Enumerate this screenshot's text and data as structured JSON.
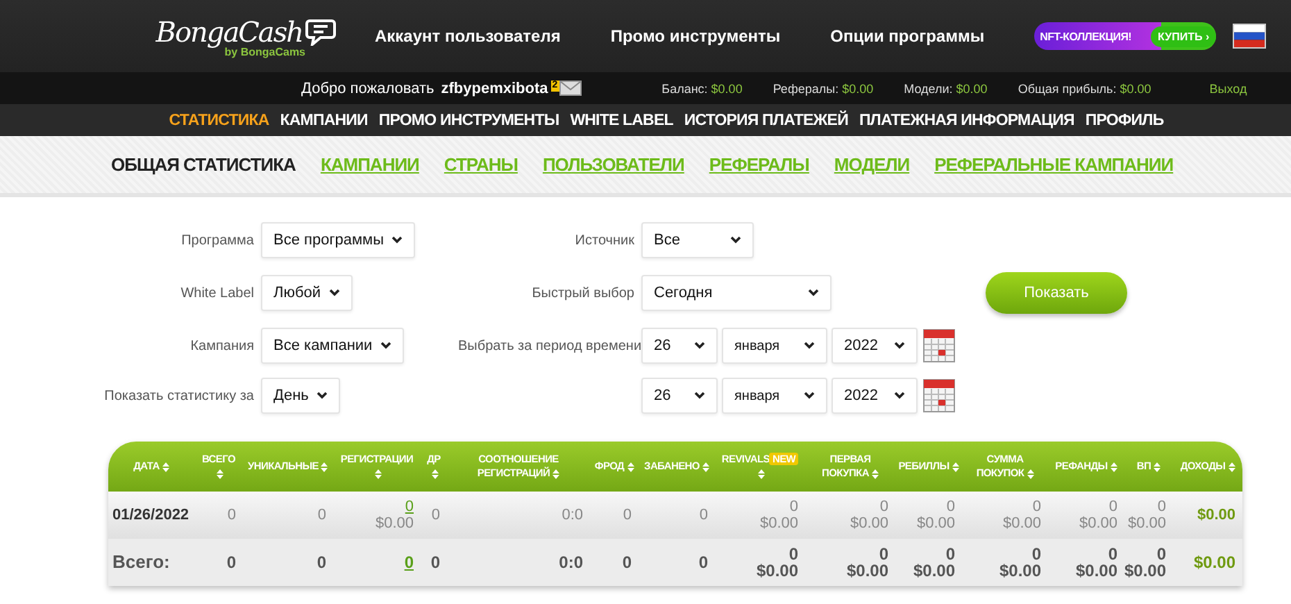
{
  "header": {
    "logo": "BongaCash",
    "logo_sub": "by BongaCams",
    "menu": [
      "Аккаунт пользователя",
      "Промо инструменты",
      "Опции программы"
    ],
    "promo": {
      "label": "NFT-КОЛЛЕКЦИЯ!",
      "action": "КУПИТЬ ›"
    }
  },
  "user_bar": {
    "greeting": "Добро пожаловать",
    "username": "zfbypemxibota",
    "messages": "2",
    "stats": [
      {
        "label": "Баланс:",
        "value": "$0.00"
      },
      {
        "label": "Рефералы:",
        "value": "$0.00"
      },
      {
        "label": "Модели:",
        "value": "$0.00"
      },
      {
        "label": "Общая прибыль:",
        "value": "$0.00"
      }
    ],
    "logout": "Выход"
  },
  "nav": [
    {
      "label": "СТАТИСТИКА",
      "selected": true
    },
    {
      "label": "КАМПАНИИ",
      "selected": false
    },
    {
      "label": "ПРОМО ИНСТРУМЕНТЫ",
      "selected": false
    },
    {
      "label": "WHITE LABEL",
      "selected": false
    },
    {
      "label": "ИСТОРИЯ ПЛАТЕЖЕЙ",
      "selected": false
    },
    {
      "label": "ПЛАТЕЖНАЯ ИНФОРМАЦИЯ",
      "selected": false
    },
    {
      "label": "ПРОФИЛЬ",
      "selected": false
    }
  ],
  "subtabs": [
    {
      "label": "ОБЩАЯ СТАТИСТИКА",
      "selected": true
    },
    {
      "label": "КАМПАНИИ",
      "selected": false
    },
    {
      "label": "СТРАНЫ",
      "selected": false
    },
    {
      "label": "ПОЛЬЗОВАТЕЛИ",
      "selected": false
    },
    {
      "label": "РЕФЕРАЛЫ",
      "selected": false
    },
    {
      "label": "МОДЕЛИ",
      "selected": false
    },
    {
      "label": "РЕФЕРАЛЬНЫЕ КАМПАНИИ",
      "selected": false
    }
  ],
  "form": {
    "rows": [
      {
        "left": {
          "label": "Программа",
          "value": "Все программы"
        },
        "right": {
          "label": "Источник",
          "kind": "select",
          "value": "Все"
        }
      },
      {
        "left": {
          "label": "White Label",
          "value": "Любой"
        },
        "right": {
          "label": "Быстрый выбор",
          "kind": "select",
          "value": "Сегодня"
        }
      },
      {
        "left": {
          "label": "Кампания",
          "value": "Все кампании"
        },
        "right": {
          "label": "Выбрать за период времени",
          "kind": "date",
          "day": "26",
          "month": "января",
          "year": "2022"
        }
      },
      {
        "left": {
          "label": "Показать статистику за",
          "value": "День"
        },
        "right": {
          "kind": "date",
          "day": "26",
          "month": "января",
          "year": "2022"
        }
      }
    ],
    "submit": "Показать"
  },
  "table": {
    "columns": [
      {
        "label": "ДАТА"
      },
      {
        "label": "ВСЕГО"
      },
      {
        "label": "УНИКАЛЬНЫЕ"
      },
      {
        "label": "РЕГИСТРАЦИИ"
      },
      {
        "label": "ДР"
      },
      {
        "label": "СООТНОШЕНИЕ РЕГИСТРАЦИЙ"
      },
      {
        "label": "ФРОД"
      },
      {
        "label": "ЗАБАНЕНО"
      },
      {
        "label": "REVIVALS",
        "badge": "NEW"
      },
      {
        "label": "ПЕРВАЯ ПОКУПКА"
      },
      {
        "label": "РЕБИЛЛЫ"
      },
      {
        "label": "СУММА ПОКУПОК"
      },
      {
        "label": "РЕФАНДЫ"
      },
      {
        "label": "ВП"
      },
      {
        "label": "ДОХОДЫ"
      }
    ],
    "rows": [
      {
        "kind": "day",
        "cells": [
          {
            "kind": "label",
            "value": "01/26/2022"
          },
          {
            "kind": "num",
            "value": "0"
          },
          {
            "kind": "num",
            "value": "0"
          },
          {
            "kind": "link",
            "value": "0",
            "sub": "$0.00"
          },
          {
            "kind": "num",
            "value": "0"
          },
          {
            "kind": "num",
            "value": "0:0"
          },
          {
            "kind": "num",
            "value": "0"
          },
          {
            "kind": "num",
            "value": "0"
          },
          {
            "kind": "num",
            "value": "0",
            "sub": "$0.00"
          },
          {
            "kind": "num",
            "value": "0",
            "sub": "$0.00"
          },
          {
            "kind": "num",
            "value": "0",
            "sub": "$0.00"
          },
          {
            "kind": "num",
            "value": "0",
            "sub": "$0.00"
          },
          {
            "kind": "num",
            "value": "0",
            "sub": "$0.00"
          },
          {
            "kind": "num",
            "value": "0",
            "sub": "$0.00"
          },
          {
            "kind": "income",
            "value": "$0.00"
          }
        ]
      },
      {
        "kind": "total",
        "cells": [
          {
            "kind": "label",
            "value": "Всего:"
          },
          {
            "kind": "num",
            "value": "0"
          },
          {
            "kind": "num",
            "value": "0"
          },
          {
            "kind": "link",
            "value": "0"
          },
          {
            "kind": "num",
            "value": "0"
          },
          {
            "kind": "num",
            "value": "0:0"
          },
          {
            "kind": "num",
            "value": "0"
          },
          {
            "kind": "num",
            "value": "0"
          },
          {
            "kind": "num",
            "value": "0",
            "sub": "$0.00"
          },
          {
            "kind": "num",
            "value": "0",
            "sub": "$0.00"
          },
          {
            "kind": "num",
            "value": "0",
            "sub": "$0.00"
          },
          {
            "kind": "num",
            "value": "0",
            "sub": "$0.00"
          },
          {
            "kind": "num",
            "value": "0",
            "sub": "$0.00"
          },
          {
            "kind": "num",
            "value": "0",
            "sub": "$0.00"
          },
          {
            "kind": "income",
            "value": "$0.00"
          }
        ]
      }
    ]
  }
}
